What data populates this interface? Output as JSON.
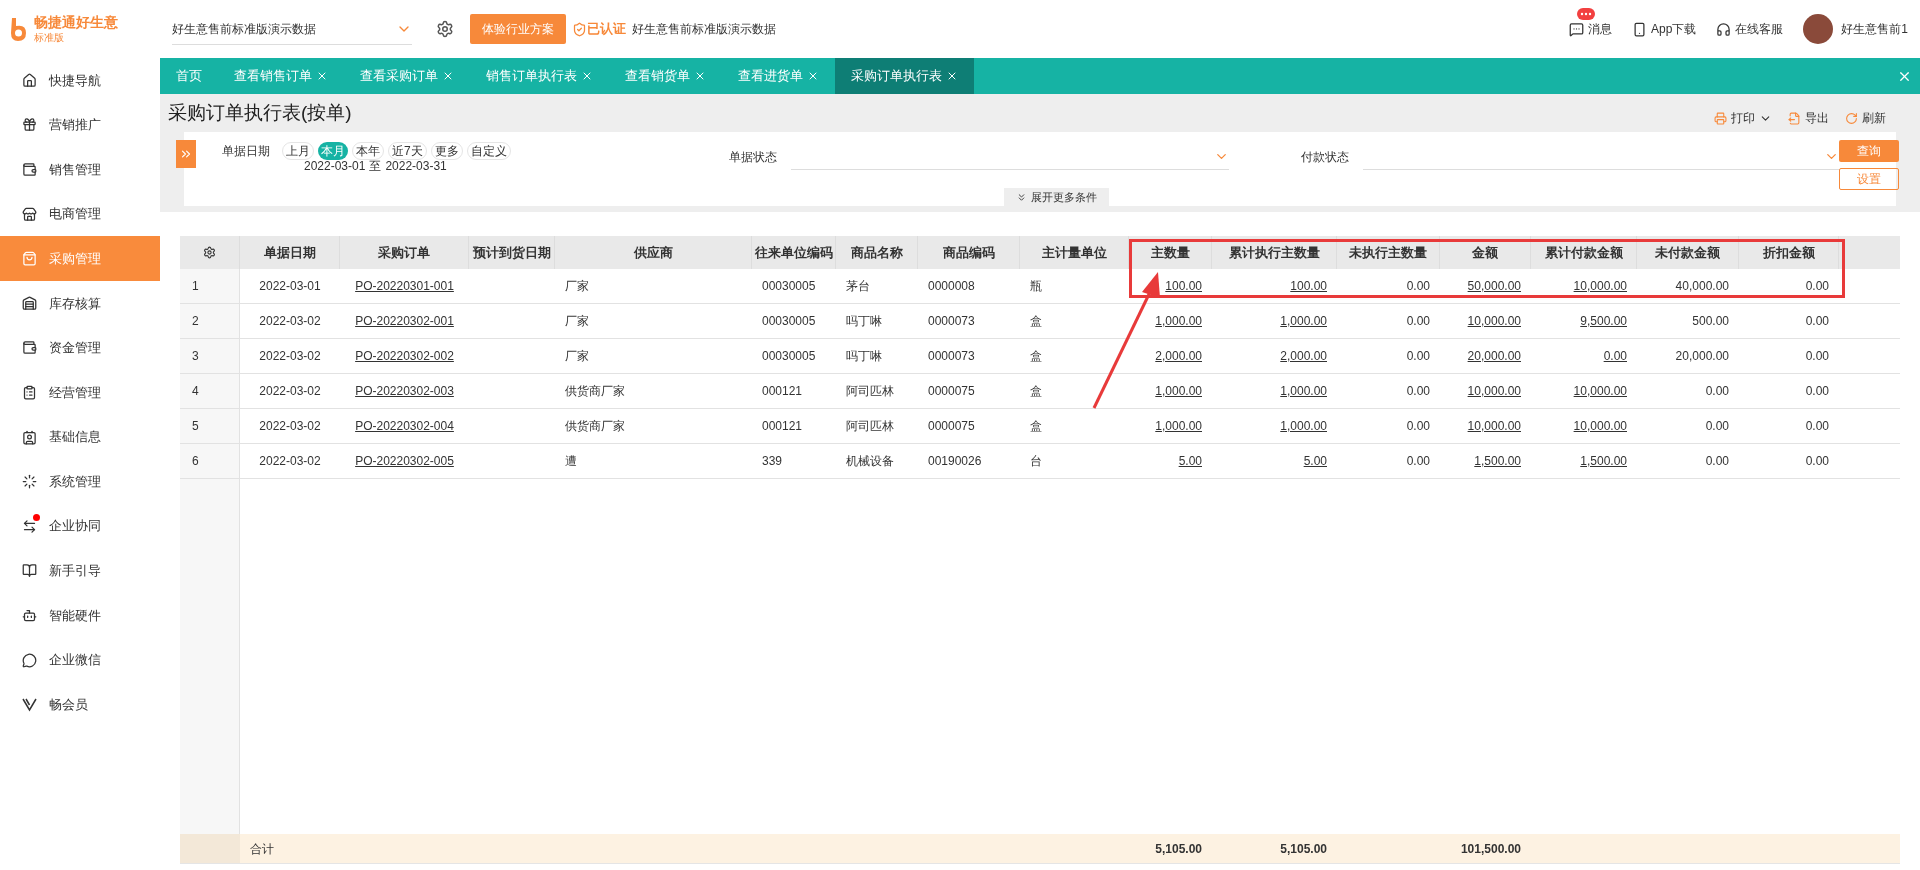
{
  "brand": {
    "name": "畅捷通好生意",
    "edition": "标准版"
  },
  "account_select": {
    "value": "好生意售前标准版演示数据"
  },
  "trial_button": "体验行业方案",
  "verified": {
    "label": "已认证",
    "org": "好生意售前标准版演示数据"
  },
  "header_actions": [
    {
      "label": "消息",
      "badge": true
    },
    {
      "label": "App下载",
      "badge": false
    },
    {
      "label": "在线客服",
      "badge": false
    }
  ],
  "user": {
    "name": "好生意售前1"
  },
  "sidebar": {
    "items": [
      {
        "label": "快捷导航",
        "selected": false,
        "badge": false
      },
      {
        "label": "营销推广",
        "selected": false,
        "badge": false
      },
      {
        "label": "销售管理",
        "selected": false,
        "badge": false
      },
      {
        "label": "电商管理",
        "selected": false,
        "badge": false
      },
      {
        "label": "采购管理",
        "selected": true,
        "badge": false
      },
      {
        "label": "库存核算",
        "selected": false,
        "badge": false
      },
      {
        "label": "资金管理",
        "selected": false,
        "badge": false
      },
      {
        "label": "经营管理",
        "selected": false,
        "badge": false
      },
      {
        "label": "基础信息",
        "selected": false,
        "badge": false
      },
      {
        "label": "系统管理",
        "selected": false,
        "badge": false
      },
      {
        "label": "企业协同",
        "selected": false,
        "badge": true
      },
      {
        "label": "新手引导",
        "selected": false,
        "badge": false
      },
      {
        "label": "智能硬件",
        "selected": false,
        "badge": false
      },
      {
        "label": "企业微信",
        "selected": false,
        "badge": false
      },
      {
        "label": "畅会员",
        "selected": false,
        "badge": false
      }
    ]
  },
  "tabs": [
    {
      "label": "首页",
      "selected": false,
      "closable": false
    },
    {
      "label": "查看销售订单",
      "selected": false,
      "closable": true
    },
    {
      "label": "查看采购订单",
      "selected": false,
      "closable": true
    },
    {
      "label": "销售订单执行表",
      "selected": false,
      "closable": true
    },
    {
      "label": "查看销货单",
      "selected": false,
      "closable": true
    },
    {
      "label": "查看进货单",
      "selected": false,
      "closable": true
    },
    {
      "label": "采购订单执行表",
      "selected": true,
      "closable": true
    }
  ],
  "page_title": "采购订单执行表(按单)",
  "toolbar": [
    {
      "label": "打印",
      "kind": "print"
    },
    {
      "label": "导出",
      "kind": "export"
    },
    {
      "label": "刷新",
      "kind": "refresh"
    }
  ],
  "filters": {
    "date_label": "单据日期",
    "quick_ranges": [
      {
        "label": "上月",
        "selected": false
      },
      {
        "label": "本月",
        "selected": true
      },
      {
        "label": "本年",
        "selected": false
      },
      {
        "label": "近7天",
        "selected": false
      },
      {
        "label": "更多",
        "selected": false
      },
      {
        "label": "自定义",
        "selected": false
      }
    ],
    "date_from": "2022-03-01",
    "date_sep": "至",
    "date_to": "2022-03-31",
    "selects": [
      {
        "label": "单据状态"
      },
      {
        "label": "付款状态"
      }
    ],
    "query_button": "查询",
    "settings_button": "设置",
    "expand": "展开更多条件"
  },
  "table": {
    "columns": [
      "单据日期",
      "采购订单",
      "预计到货日期",
      "供应商",
      "往来单位编码",
      "商品名称",
      "商品编码",
      "主计量单位",
      "主数量",
      "累计执行主数量",
      "未执行主数量",
      "金额",
      "累计付款金额",
      "未付款金额",
      "折扣金额"
    ],
    "rows": [
      {
        "no": "1",
        "cells": [
          "2022-03-01",
          {
            "text": "PO-20220301-001",
            "link": true
          },
          "",
          "厂家",
          "00030005",
          "茅台",
          "0000008",
          "瓶",
          {
            "text": "100.00",
            "link": true
          },
          {
            "text": "100.00",
            "link": true
          },
          "0.00",
          {
            "text": "50,000.00",
            "link": true
          },
          {
            "text": "10,000.00",
            "link": true
          },
          "40,000.00",
          "0.00"
        ]
      },
      {
        "no": "2",
        "cells": [
          "2022-03-02",
          {
            "text": "PO-20220302-001",
            "link": true
          },
          "",
          "厂家",
          "00030005",
          "吗丁啉",
          "0000073",
          "盒",
          {
            "text": "1,000.00",
            "link": true
          },
          {
            "text": "1,000.00",
            "link": true
          },
          "0.00",
          {
            "text": "10,000.00",
            "link": true
          },
          {
            "text": "9,500.00",
            "link": true
          },
          "500.00",
          "0.00"
        ]
      },
      {
        "no": "3",
        "cells": [
          "2022-03-02",
          {
            "text": "PO-20220302-002",
            "link": true
          },
          "",
          "厂家",
          "00030005",
          "吗丁啉",
          "0000073",
          "盒",
          {
            "text": "2,000.00",
            "link": true
          },
          {
            "text": "2,000.00",
            "link": true
          },
          "0.00",
          {
            "text": "20,000.00",
            "link": true
          },
          {
            "text": "0.00",
            "link": true
          },
          "20,000.00",
          "0.00"
        ]
      },
      {
        "no": "4",
        "cells": [
          "2022-03-02",
          {
            "text": "PO-20220302-003",
            "link": true
          },
          "",
          "供货商厂家",
          "000121",
          "阿司匹林",
          "0000075",
          "盒",
          {
            "text": "1,000.00",
            "link": true
          },
          {
            "text": "1,000.00",
            "link": true
          },
          "0.00",
          {
            "text": "10,000.00",
            "link": true
          },
          {
            "text": "10,000.00",
            "link": true
          },
          "0.00",
          "0.00"
        ]
      },
      {
        "no": "5",
        "cells": [
          "2022-03-02",
          {
            "text": "PO-20220302-004",
            "link": true
          },
          "",
          "供货商厂家",
          "000121",
          "阿司匹林",
          "0000075",
          "盒",
          {
            "text": "1,000.00",
            "link": true
          },
          {
            "text": "1,000.00",
            "link": true
          },
          "0.00",
          {
            "text": "10,000.00",
            "link": true
          },
          {
            "text": "10,000.00",
            "link": true
          },
          "0.00",
          "0.00"
        ]
      },
      {
        "no": "6",
        "cells": [
          "2022-03-02",
          {
            "text": "PO-20220302-005",
            "link": true
          },
          "",
          "遭",
          "339",
          "机械设备",
          "00190026",
          "台",
          {
            "text": "5.00",
            "link": true
          },
          {
            "text": "5.00",
            "link": true
          },
          "0.00",
          {
            "text": "1,500.00",
            "link": true
          },
          {
            "text": "1,500.00",
            "link": true
          },
          "0.00",
          "0.00"
        ]
      }
    ],
    "footer": {
      "label": "合计",
      "quantity": "5,105.00",
      "executed_quantity": "5,105.00",
      "amount": "101,500.00"
    }
  }
}
